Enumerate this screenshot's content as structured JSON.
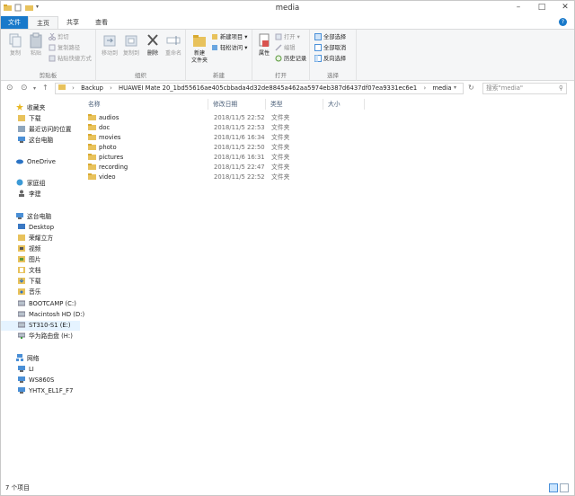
{
  "window": {
    "title": "media",
    "controls": [
      "minimize-icon",
      "maximize-icon",
      "close-icon"
    ]
  },
  "ribbon_tabs": [
    "文件",
    "主页",
    "共享",
    "查看"
  ],
  "ribbon": {
    "clipboard": {
      "label": "剪贴板",
      "copy": "复制",
      "paste": "粘贴",
      "cut": "剪切",
      "copy_path": "复制路径",
      "paste_shortcut": "粘贴快捷方式"
    },
    "organize": {
      "label": "组织",
      "move_to": "移动到",
      "copy_to": "复制到",
      "delete": "删除",
      "rename": "重命名"
    },
    "new": {
      "label": "新建",
      "new_folder": "新建\n文件夹",
      "new_item": "新建项目 ▾",
      "easy_access": "轻松访问 ▾"
    },
    "open": {
      "label": "打开",
      "properties": "属性",
      "open": "打开 ▾",
      "edit": "编辑",
      "history": "历史记录"
    },
    "select": {
      "label": "选择",
      "select_all": "全部选择",
      "select_none": "全部取消",
      "invert": "反向选择"
    }
  },
  "address": {
    "crumbs": [
      "Backup",
      "HUAWEI Mate 20_1bd55616ae405cbbada4d32de8845a462aa5974eb387d6437df07ea9331ec6e1",
      "media"
    ],
    "search_placeholder": "搜索\"media\""
  },
  "nav": {
    "favorites": {
      "label": "收藏夹",
      "items": [
        "下载",
        "最近访问的位置",
        "这台电脑"
      ]
    },
    "onedrive": "OneDrive",
    "homegroup": {
      "label": "家庭组",
      "items": [
        "李建"
      ]
    },
    "thispc": {
      "label": "这台电脑",
      "items": [
        "Desktop",
        "荣耀立方",
        "视频",
        "图片",
        "文档",
        "下载",
        "音乐",
        "BOOTCAMP (C:)",
        "Macintosh HD (D:)",
        "ST310-S1 (E:)",
        "华为路由盘 (H:)"
      ]
    },
    "network": {
      "label": "网络",
      "items": [
        "LI",
        "WS860S",
        "YHTX_EL1F_F7"
      ]
    }
  },
  "columns": {
    "name": "名称",
    "modified": "修改日期",
    "type": "类型",
    "size": "大小"
  },
  "files": [
    {
      "name": "audios",
      "date": "2018/11/5 22:52",
      "type": "文件夹"
    },
    {
      "name": "doc",
      "date": "2018/11/5 22:53",
      "type": "文件夹"
    },
    {
      "name": "movies",
      "date": "2018/11/6 16:34",
      "type": "文件夹"
    },
    {
      "name": "photo",
      "date": "2018/11/5 22:50",
      "type": "文件夹"
    },
    {
      "name": "pictures",
      "date": "2018/11/6 16:31",
      "type": "文件夹"
    },
    {
      "name": "recording",
      "date": "2018/11/5 22:47",
      "type": "文件夹"
    },
    {
      "name": "video",
      "date": "2018/11/5 22:52",
      "type": "文件夹"
    }
  ],
  "status": {
    "count": "7 个项目"
  },
  "colors": {
    "accent": "#1979ca",
    "folder": "#e8c25c",
    "selected": "#e5f3ff"
  }
}
